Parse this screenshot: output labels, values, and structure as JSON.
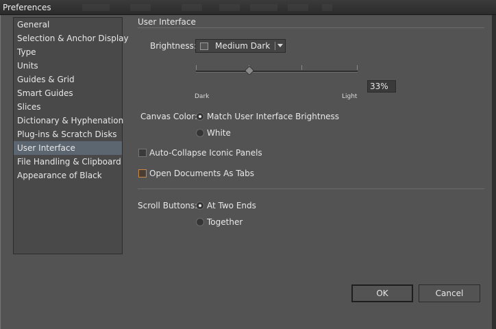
{
  "window": {
    "title": "Preferences"
  },
  "sidebar": {
    "items": [
      {
        "label": "General",
        "selected": false
      },
      {
        "label": "Selection & Anchor Display",
        "selected": false
      },
      {
        "label": "Type",
        "selected": false
      },
      {
        "label": "Units",
        "selected": false
      },
      {
        "label": "Guides & Grid",
        "selected": false
      },
      {
        "label": "Smart Guides",
        "selected": false
      },
      {
        "label": "Slices",
        "selected": false
      },
      {
        "label": "Dictionary & Hyphenation",
        "selected": false
      },
      {
        "label": "Plug-ins & Scratch Disks",
        "selected": false
      },
      {
        "label": "User Interface",
        "selected": true
      },
      {
        "label": "File Handling & Clipboard",
        "selected": false
      },
      {
        "label": "Appearance of Black",
        "selected": false
      }
    ]
  },
  "panel": {
    "title": "User Interface",
    "brightness": {
      "label": "Brightness:",
      "value": "Medium Dark",
      "slider_min_label": "Dark",
      "slider_max_label": "Light",
      "slider_level": 0.33,
      "percent_text": "33%"
    },
    "canvas_color": {
      "label": "Canvas Color:",
      "options": [
        {
          "label": "Match User Interface Brightness",
          "checked": true
        },
        {
          "label": "White",
          "checked": false
        }
      ]
    },
    "auto_collapse": {
      "label": "Auto-Collapse Iconic Panels",
      "checked": false
    },
    "open_as_tabs": {
      "label": "Open Documents As Tabs",
      "checked": false
    },
    "scroll_buttons": {
      "label": "Scroll Buttons:",
      "options": [
        {
          "label": "At Two Ends",
          "checked": true
        },
        {
          "label": "Together",
          "checked": false
        }
      ]
    }
  },
  "buttons": {
    "ok": "OK",
    "cancel": "Cancel"
  },
  "colors": {
    "dialog_bg": "#535353",
    "selection": "#5c6670",
    "focus": "#c98a4a"
  }
}
